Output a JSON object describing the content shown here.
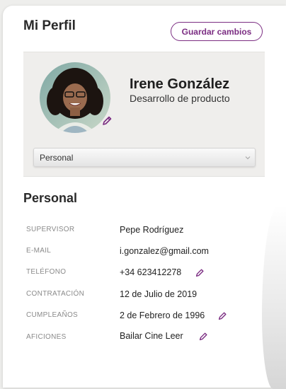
{
  "page": {
    "title": "Mi Perfil",
    "save_label": "Guardar cambios"
  },
  "profile": {
    "name": "Irene González",
    "role": "Desarrollo de producto",
    "avatar_icon": "avatar-photo",
    "edit_icon": "pencil-icon"
  },
  "section_select": {
    "value": "Personal"
  },
  "section": {
    "title": "Personal",
    "fields": [
      {
        "label": "SUPERVISOR",
        "value": "Pepe Rodríguez",
        "editable": false
      },
      {
        "label": "E-MAIL",
        "value": "i.gonzalez@gmail.com",
        "editable": false
      },
      {
        "label": "TELÉFONO",
        "value": "+34 623412278",
        "editable": true
      },
      {
        "label": "CONTRATACIÓN",
        "value": "12 de Julio de 2019",
        "editable": false
      },
      {
        "label": "CUMPLEAÑOS",
        "value": "2 de Febrero de 1996",
        "editable": true
      },
      {
        "label": "AFICIONES",
        "value": "Bailar Cine Leer",
        "editable": true
      }
    ]
  },
  "colors": {
    "accent": "#7b2d82",
    "panel": "#efeeec"
  }
}
